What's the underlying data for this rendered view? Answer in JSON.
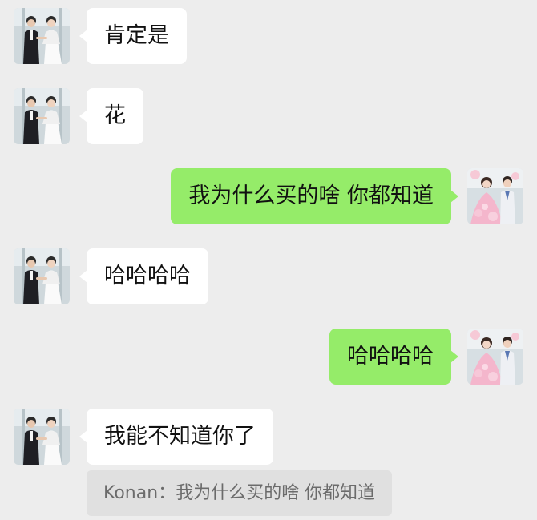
{
  "chat": {
    "messages": [
      {
        "sender": "other",
        "text": "肯定是"
      },
      {
        "sender": "other",
        "text": "花"
      },
      {
        "sender": "self",
        "text": "我为什么买的啥 你都知道"
      },
      {
        "sender": "other",
        "text": "哈哈哈哈"
      },
      {
        "sender": "self",
        "text": "哈哈哈哈"
      },
      {
        "sender": "other",
        "text": "我能不知道你了"
      }
    ],
    "quote": {
      "author": "Konan",
      "separator": "：",
      "text": "我为什么买的啥 你都知道"
    }
  },
  "avatars": {
    "other": "wedding-couple-photo",
    "self": "pink-gown-couple-photo"
  },
  "colors": {
    "background": "#ededed",
    "incoming_bubble": "#ffffff",
    "outgoing_bubble": "#95ec69",
    "quote_background": "#e0e0e0",
    "quote_text": "#6b6b6b"
  }
}
